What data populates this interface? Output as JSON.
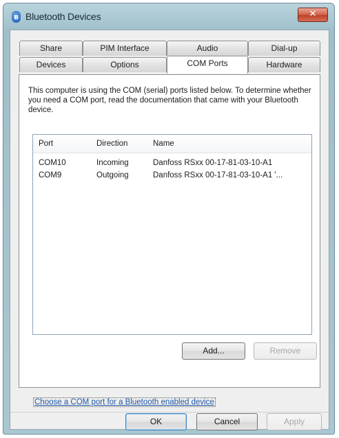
{
  "window": {
    "title": "Bluetooth Devices",
    "close_glyph": "✕"
  },
  "tabs_back": [
    {
      "label": "Share"
    },
    {
      "label": "PIM Interface"
    },
    {
      "label": "Audio"
    },
    {
      "label": "Dial-up"
    }
  ],
  "tabs_front": [
    {
      "label": "Devices"
    },
    {
      "label": "Options"
    },
    {
      "label": "COM Ports",
      "active": true
    },
    {
      "label": "Hardware"
    }
  ],
  "description": "This computer is using the COM (serial) ports listed below. To determine whether you need a COM port, read the documentation that came with your Bluetooth device.",
  "port_list": {
    "columns": [
      "Port",
      "Direction",
      "Name"
    ],
    "rows": [
      {
        "port": "COM10",
        "direction": "Incoming",
        "name": "Danfoss RSxx 00-17-81-03-10-A1"
      },
      {
        "port": "COM9",
        "direction": "Outgoing",
        "name": "Danfoss RSxx 00-17-81-03-10-A1 '..."
      }
    ]
  },
  "buttons": {
    "add": "Add...",
    "remove": "Remove",
    "ok": "OK",
    "cancel": "Cancel",
    "apply": "Apply"
  },
  "help_link": "Choose a COM port for a Bluetooth enabled device",
  "icons": {
    "app": "bluetooth-icon",
    "close": "close-icon"
  }
}
